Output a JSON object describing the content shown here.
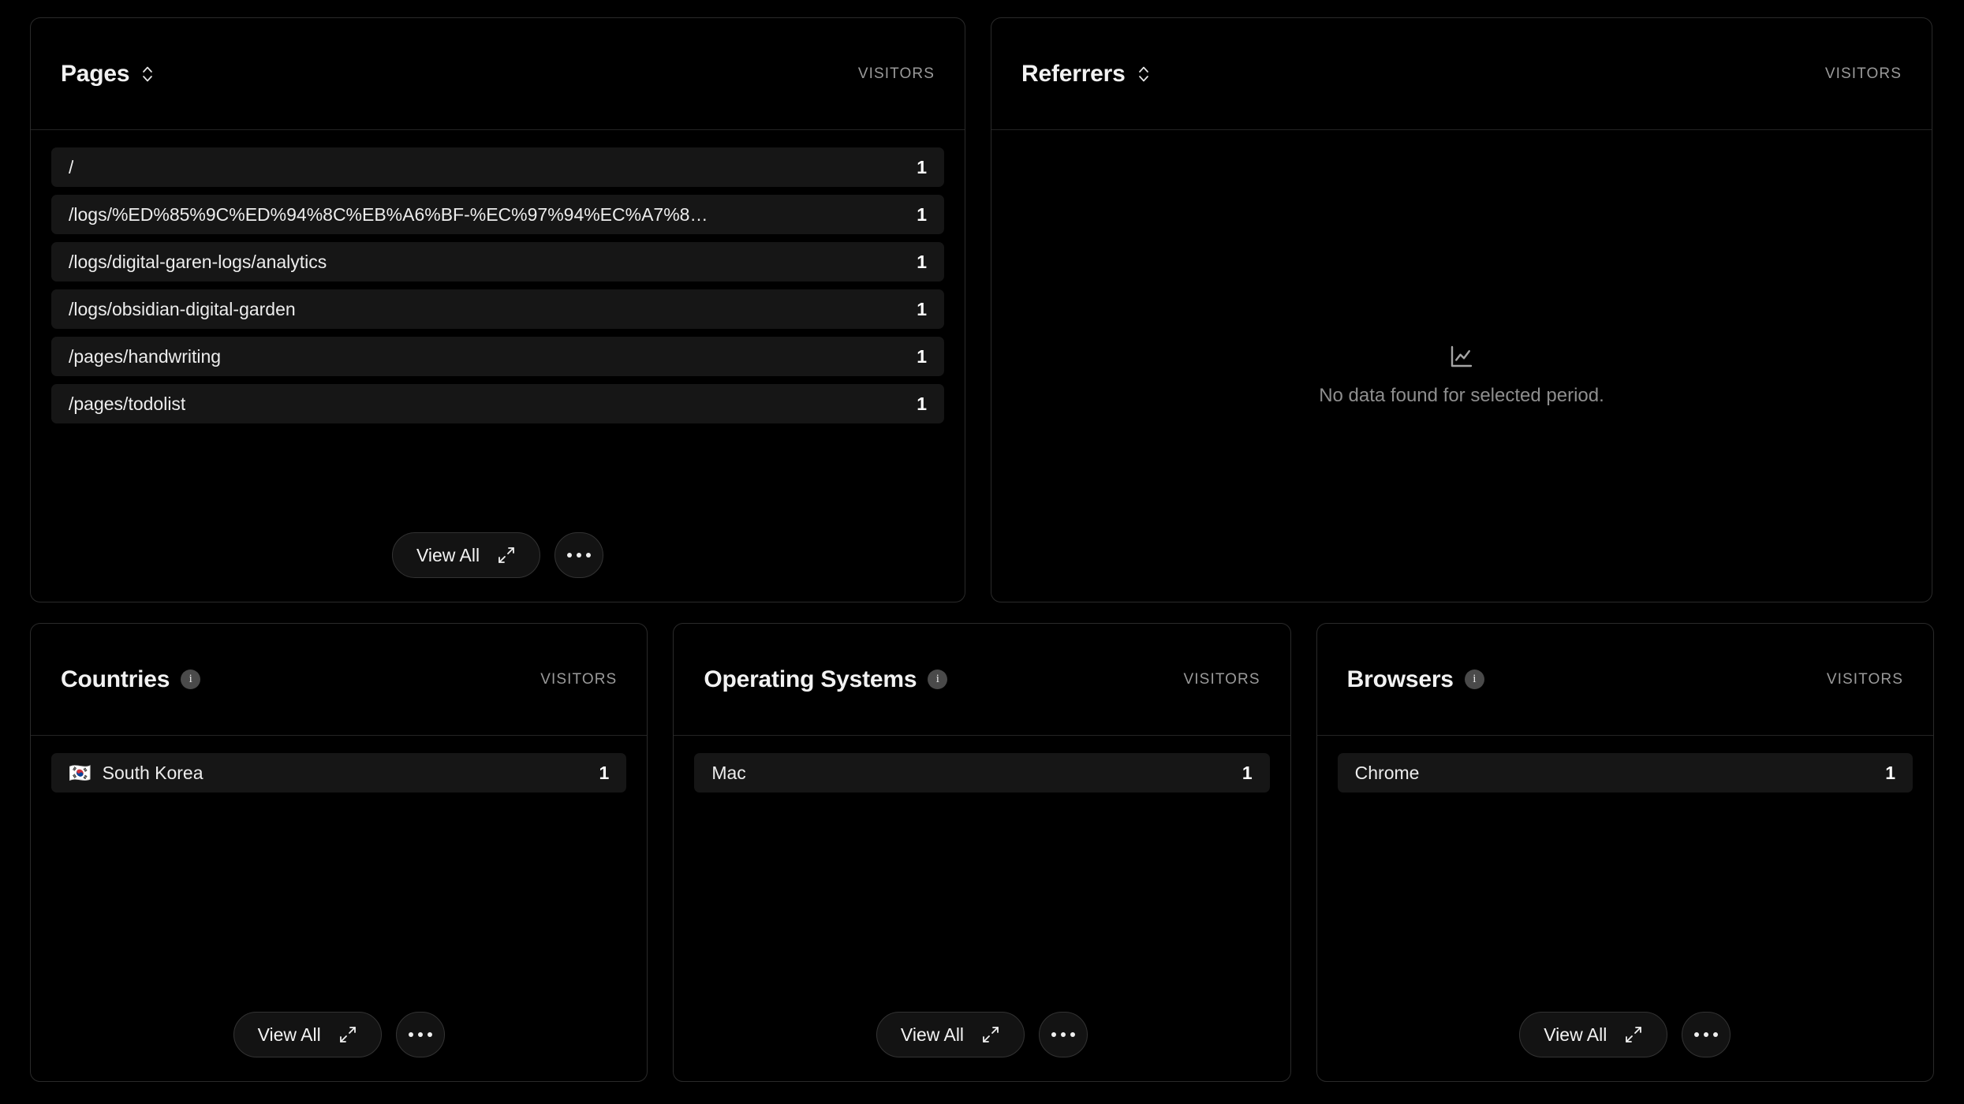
{
  "theme": {
    "background": "#000000",
    "card_border": "#2a2a2a",
    "row_background": "#161616",
    "text_primary": "#ededed",
    "text_muted": "#9a9a9a"
  },
  "metric_label": "VISITORS",
  "actions": {
    "view_all": "View All",
    "more": "…"
  },
  "cards": {
    "pages": {
      "title": "Pages",
      "metric": "VISITORS",
      "rows": [
        {
          "label": "/",
          "value": "1"
        },
        {
          "label": "/logs/%ED%85%9C%ED%94%8C%EB%A6%BF-%EC%97%94%EC%A7%8…",
          "value": "1"
        },
        {
          "label": "/logs/digital-garen-logs/analytics",
          "value": "1"
        },
        {
          "label": "/logs/obsidian-digital-garden",
          "value": "1"
        },
        {
          "label": "/pages/handwriting",
          "value": "1"
        },
        {
          "label": "/pages/todolist",
          "value": "1"
        }
      ]
    },
    "referrers": {
      "title": "Referrers",
      "metric": "VISITORS",
      "empty_message": "No data found for selected period."
    },
    "countries": {
      "title": "Countries",
      "metric": "VISITORS",
      "rows": [
        {
          "flag": "🇰🇷",
          "label": "South Korea",
          "value": "1"
        }
      ]
    },
    "operating_systems": {
      "title": "Operating Systems",
      "metric": "VISITORS",
      "rows": [
        {
          "label": "Mac",
          "value": "1"
        }
      ]
    },
    "browsers": {
      "title": "Browsers",
      "metric": "VISITORS",
      "rows": [
        {
          "label": "Chrome",
          "value": "1"
        }
      ]
    }
  }
}
